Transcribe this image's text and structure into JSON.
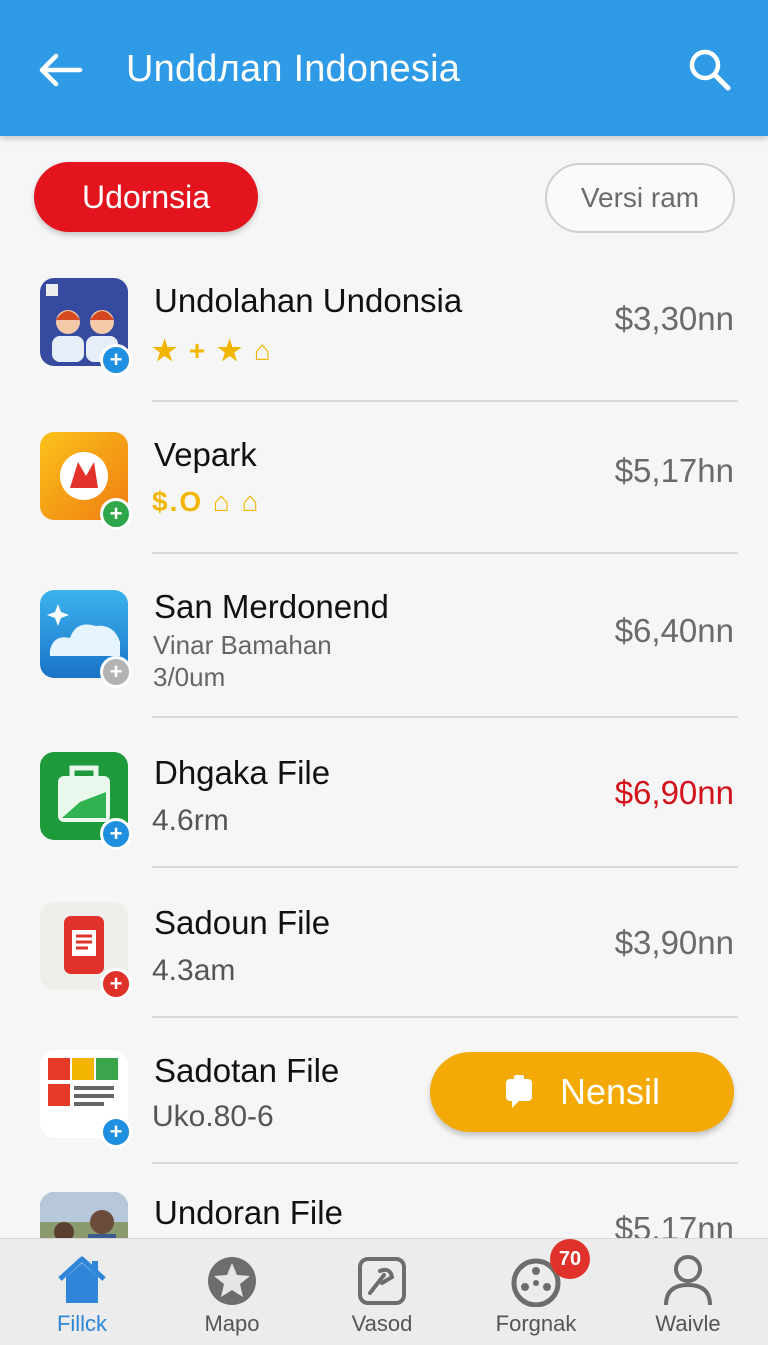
{
  "header": {
    "title": "Unddлan Indonesia"
  },
  "filters": {
    "primary": "Udornsia",
    "secondary": "Versi ram"
  },
  "items": [
    {
      "name": "Undolahan Undonsia",
      "rating_text": "★ + ★ ⌂",
      "price": "$3,30nn",
      "badge": "+"
    },
    {
      "name": "Vepark",
      "rating_text": "$.O ⌂ ⌂",
      "price": "$5,17hn",
      "badge": "+"
    },
    {
      "name": "San Merdonend",
      "sub1": "Vinar Bamahan",
      "sub2": "3/0um",
      "price": "$6,40nn",
      "badge": "+"
    },
    {
      "name": "Dhgaka File",
      "meta": "4.6rm",
      "price": "$6,90nn",
      "badge": "+"
    },
    {
      "name": "Sadoun File",
      "meta": "4.3am",
      "price": "$3,90nn",
      "badge": "+"
    },
    {
      "name": "Sadotan File",
      "meta": "Uko.80-6",
      "action_label": "Nensil",
      "badge": "+"
    },
    {
      "name": "Undoran File",
      "price": "$5,17nn"
    }
  ],
  "nav": [
    {
      "label": "Fillck"
    },
    {
      "label": "Mapo"
    },
    {
      "label": "Vasod"
    },
    {
      "label": "Forgnak",
      "badge": "70"
    },
    {
      "label": "Waivle"
    }
  ],
  "colors": {
    "appbar": "#2f9be6",
    "accent_red": "#e3141e",
    "install": "#f3aa06",
    "nav_active": "#2f86d8"
  }
}
